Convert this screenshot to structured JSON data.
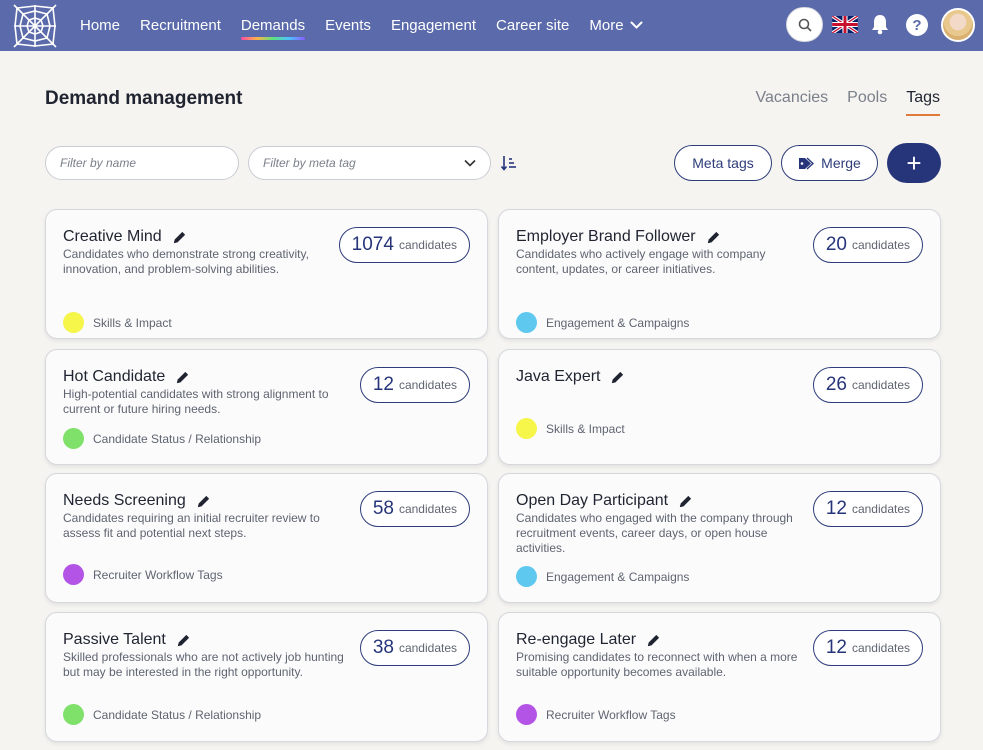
{
  "nav": {
    "links": [
      "Home",
      "Recruitment",
      "Demands",
      "Events",
      "Engagement",
      "Career site",
      "More"
    ]
  },
  "page": {
    "title": "Demand management",
    "tabs": [
      "Vacancies",
      "Pools",
      "Tags"
    ]
  },
  "filters": {
    "name_placeholder": "Filter by name",
    "meta_placeholder": "Filter by meta tag"
  },
  "toolbar": {
    "meta_tags_label": "Meta tags",
    "merge_label": "Merge",
    "add_label": "+"
  },
  "colors": {
    "nav": "#5a6aaa",
    "primary": "#26357a",
    "tab_active": "#e07a3a",
    "skills": "#f5f54a",
    "engagement": "#5ec8ef",
    "status": "#7fe06a",
    "workflow": "#b454e6"
  },
  "cards": [
    {
      "title": "Creative Mind",
      "description": "Candidates who demonstrate strong creativity, innovation, and problem-solving abilities.",
      "count": "1074",
      "count_label": "candidates",
      "meta": "Skills & Impact",
      "meta_color": "#f5f54a"
    },
    {
      "title": "Employer Brand Follower",
      "description": "Candidates who actively engage with company content, updates, or career initiatives.",
      "count": "20",
      "count_label": "candidates",
      "meta": "Engagement & Campaigns",
      "meta_color": "#5ec8ef"
    },
    {
      "title": "Hot Candidate",
      "description": "High-potential candidates with strong alignment to current or future hiring needs.",
      "count": "12",
      "count_label": "candidates",
      "meta": "Candidate Status / Relationship",
      "meta_color": "#7fe06a"
    },
    {
      "title": "Java Expert",
      "description": "",
      "count": "26",
      "count_label": "candidates",
      "meta": "Skills & Impact",
      "meta_color": "#f5f54a"
    },
    {
      "title": "Needs Screening",
      "description": "Candidates requiring an initial recruiter review to assess fit and potential next steps.",
      "count": "58",
      "count_label": "candidates",
      "meta": "Recruiter Workflow Tags",
      "meta_color": "#b454e6"
    },
    {
      "title": "Open Day Participant",
      "description": "Candidates who engaged with the company through recruitment events, career days, or open house activities.",
      "count": "12",
      "count_label": "candidates",
      "meta": "Engagement & Campaigns",
      "meta_color": "#5ec8ef"
    },
    {
      "title": "Passive Talent",
      "description": "Skilled professionals who are not actively job hunting but may be interested in the right opportunity.",
      "count": "38",
      "count_label": "candidates",
      "meta": "Candidate Status / Relationship",
      "meta_color": "#7fe06a"
    },
    {
      "title": "Re-engage Later",
      "description": "Promising candidates to reconnect with when a more suitable opportunity becomes available.",
      "count": "12",
      "count_label": "candidates",
      "meta": "Recruiter Workflow Tags",
      "meta_color": "#b454e6"
    }
  ]
}
